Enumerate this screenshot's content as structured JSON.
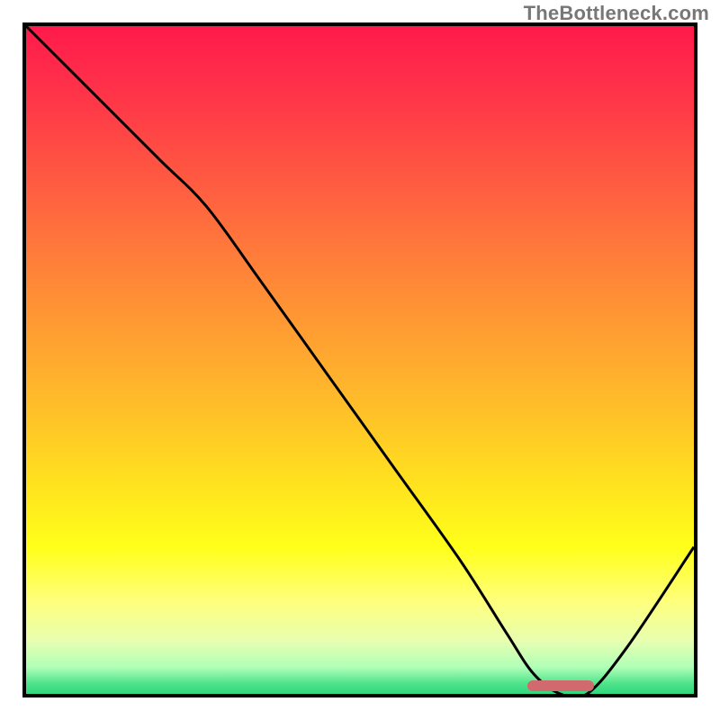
{
  "watermark": "TheBottleneck.com",
  "colors": {
    "frame": "#000000",
    "curve": "#000000",
    "marker": "#d16a6f",
    "gradient_stops": [
      {
        "offset": 0.0,
        "color": "#ff1a4b"
      },
      {
        "offset": 0.1,
        "color": "#ff3349"
      },
      {
        "offset": 0.25,
        "color": "#ff6040"
      },
      {
        "offset": 0.4,
        "color": "#ff8d36"
      },
      {
        "offset": 0.55,
        "color": "#ffb82b"
      },
      {
        "offset": 0.68,
        "color": "#ffe01f"
      },
      {
        "offset": 0.78,
        "color": "#ffff1a"
      },
      {
        "offset": 0.86,
        "color": "#ffff7a"
      },
      {
        "offset": 0.92,
        "color": "#e8ffb0"
      },
      {
        "offset": 0.96,
        "color": "#b0ffb8"
      },
      {
        "offset": 0.985,
        "color": "#4de38a"
      },
      {
        "offset": 1.0,
        "color": "#2fd87f"
      }
    ]
  },
  "chart_data": {
    "type": "line",
    "title": "",
    "xlabel": "",
    "ylabel": "",
    "xlim": [
      0,
      100
    ],
    "ylim": [
      0,
      100
    ],
    "grid": false,
    "series": [
      {
        "name": "bottleneck-curve",
        "x": [
          0,
          10,
          20,
          27,
          35,
          45,
          55,
          65,
          72,
          76,
          80,
          84,
          90,
          100
        ],
        "y": [
          100,
          90,
          80,
          73,
          62,
          48,
          34,
          20,
          9,
          3,
          0,
          0,
          7,
          22
        ]
      }
    ],
    "annotations": [
      {
        "name": "optimal-marker",
        "shape": "rounded-bar",
        "x_range": [
          75,
          85
        ],
        "y": 1.2,
        "color": "#d16a6f"
      }
    ]
  }
}
